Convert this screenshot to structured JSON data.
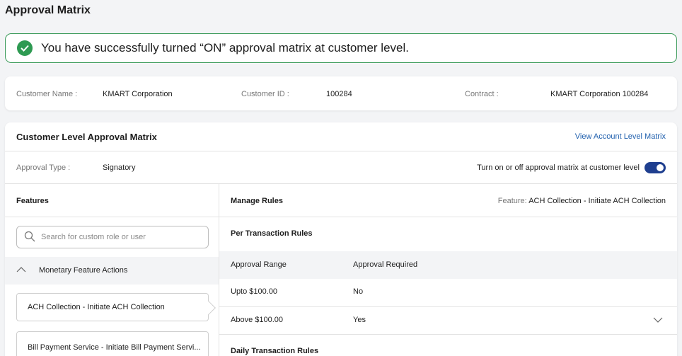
{
  "page_title": "Approval Matrix",
  "toast": {
    "message": "You have successfully turned “ON” approval matrix at customer level."
  },
  "customer_info": {
    "name_label": "Customer Name :",
    "name_value": "KMART Corporation",
    "id_label": "Customer ID :",
    "id_value": "100284",
    "contract_label": "Contract :",
    "contract_value": "KMART Corporation 100284"
  },
  "matrix": {
    "title": "Customer Level Approval Matrix",
    "view_account_link": "View Account Level Matrix",
    "approval_type_label": "Approval Type :",
    "approval_type_value": "Signatory",
    "toggle_label": "Turn on or off approval matrix at customer level",
    "toggle_on": true
  },
  "features": {
    "header": "Features",
    "search_placeholder": "Search for custom role or user",
    "group_label": "Monetary Feature Actions",
    "items": [
      {
        "label": "ACH Collection - Initiate ACH Collection",
        "selected": true
      },
      {
        "label": "Bill Payment Service - Initiate Bill Payment Servi..."
      }
    ]
  },
  "rules": {
    "header": "Manage Rules",
    "feature_label": "Feature:",
    "feature_value": "ACH Collection - Initiate ACH Collection",
    "per_transaction_title": "Per Transaction Rules",
    "columns": [
      "Approval Range",
      "Approval Required"
    ],
    "rows": [
      {
        "range": "Upto $100.00",
        "required": "No"
      },
      {
        "range": "Above $100.00",
        "required": "Yes"
      }
    ],
    "daily_title": "Daily Transaction Rules"
  },
  "colors": {
    "success": "#2e9a52",
    "link": "#1f5fad",
    "toggle": "#1f3f8f"
  },
  "icons": [
    "check-circle-icon",
    "search-icon",
    "chevron-up-icon",
    "chevron-down-icon"
  ]
}
